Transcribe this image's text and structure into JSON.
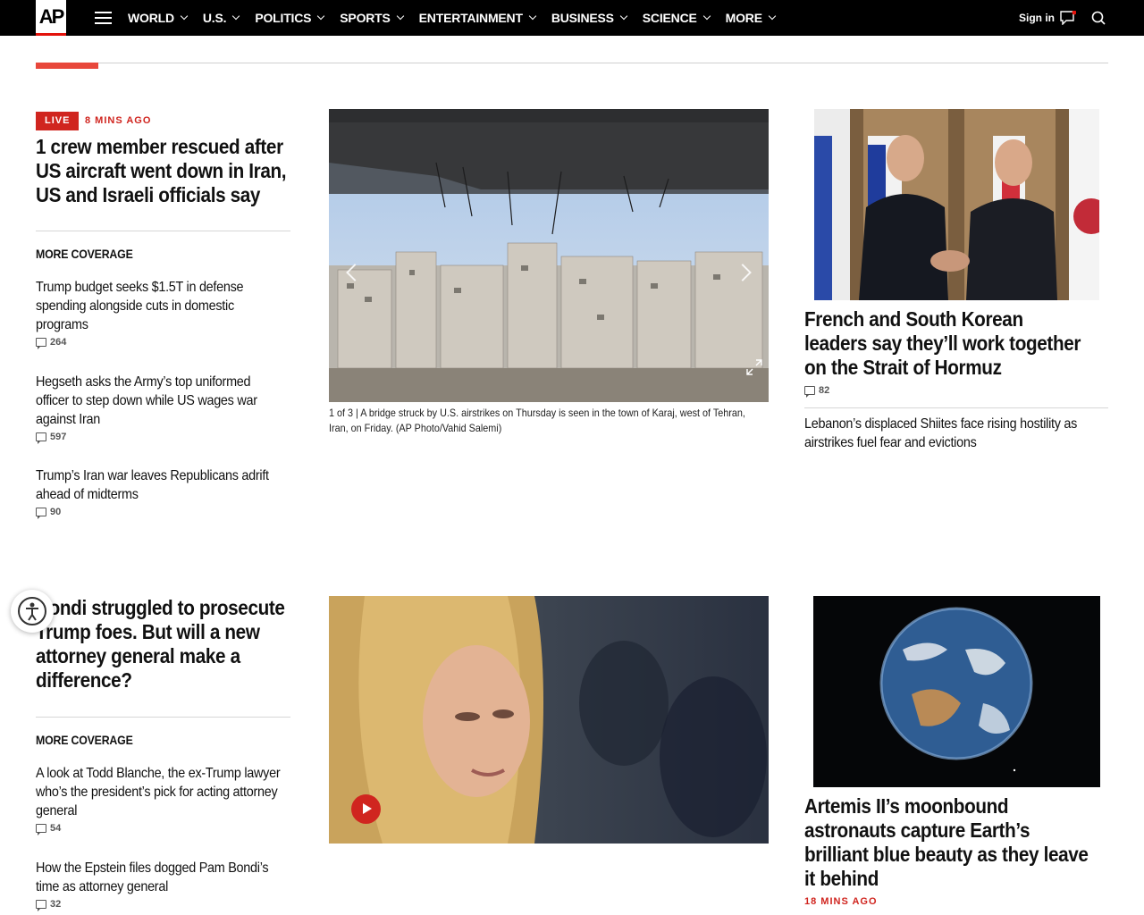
{
  "nav": {
    "logo": "AP",
    "items": [
      "WORLD",
      "U.S.",
      "POLITICS",
      "SPORTS",
      "ENTERTAINMENT",
      "BUSINESS",
      "SCIENCE",
      "MORE"
    ],
    "signin": "Sign in"
  },
  "row1": {
    "live_label": "LIVE",
    "time_ago": "8 MINS AGO",
    "headline": "1 crew member rescued after US aircraft went down in Iran, US and Israeli officials say",
    "more_coverage": "MORE COVERAGE",
    "stories": [
      {
        "title": "Trump budget seeks $1.5T in defense spending alongside cuts in domestic programs",
        "comments": "264"
      },
      {
        "title": "Hegseth asks the Army’s top uniformed officer to step down while US wages war against Iran",
        "comments": "597"
      },
      {
        "title": "Trump’s Iran war leaves Republicans adrift ahead of midterms",
        "comments": "90"
      }
    ],
    "caption": "1 of 3 |  A bridge struck by U.S. airstrikes on Thursday is seen in the town of Karaj, west of Tehran, Iran, on Friday. (AP Photo/Vahid Salemi)",
    "right_headline": "French and South Korean leaders say they’ll work together on the Strait of Hormuz",
    "right_comments": "82",
    "right_story": "Lebanon’s displaced Shiites face rising hostility as airstrikes fuel fear and evictions"
  },
  "row2": {
    "headline": "Bondi struggled to prosecute Trump foes. But will a new attorney general make a difference?",
    "more_coverage": "MORE COVERAGE",
    "stories": [
      {
        "title": "A look at Todd Blanche, the ex-Trump lawyer who’s the president’s pick for acting attorney general",
        "comments": "54"
      },
      {
        "title": "How the Epstein files dogged Pam Bondi’s time as attorney general",
        "comments": "32"
      }
    ],
    "right_headline": "Artemis II’s moonbound astronauts capture Earth’s brilliant blue beauty as they leave it behind",
    "right_time": "18 MINS AGO"
  },
  "colors": {
    "accent": "#d0251f",
    "nav_bg": "#000000"
  }
}
